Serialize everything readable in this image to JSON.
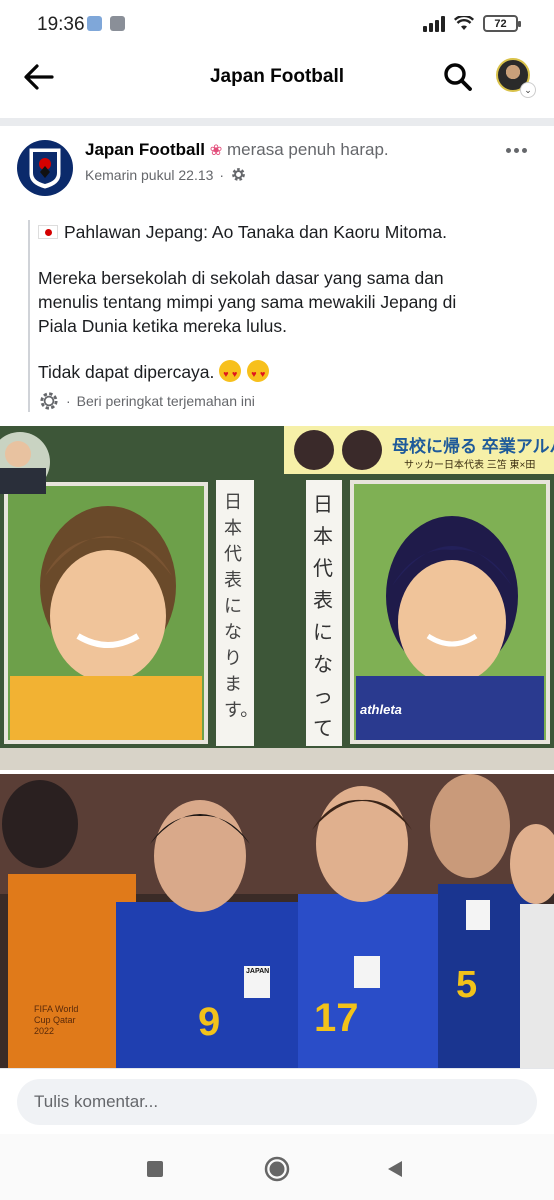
{
  "status_bar": {
    "time": "19:36",
    "battery": "72"
  },
  "header": {
    "title": "Japan Football"
  },
  "post": {
    "author": "Japan Football",
    "feeling": "merasa penuh harap.",
    "timestamp": "Kemarin pukul 22.13",
    "lines": {
      "l1": "Pahlawan Jepang: Ao Tanaka dan Kaoru Mitoma.",
      "l2": "Mereka bersekolah di sekolah dasar yang sama dan",
      "l3": "menulis tentang mimpi yang sama mewakili Jepang di",
      "l4": "Piala Dunia ketika mereka lulus.",
      "l5": "Tidak dapat dipercaya."
    },
    "translation_label": "Beri peringkat terjemahan ini"
  },
  "image_top": {
    "banner_jp": "母校に帰る 卒業アルバム",
    "subbanner_jp": "サッカー日本代表 三笘 東×田",
    "card_left_jp": "日本代表になります。",
    "card_right_jp": "日本代表になって",
    "shirt_text": "athleta"
  },
  "image_bottom": {
    "player_numbers": [
      "9",
      "17",
      "5"
    ],
    "crest_text": "JAPAN",
    "bib_text": "FIFA World Cup Qatar 2022"
  },
  "comment": {
    "placeholder": "Tulis komentar..."
  },
  "icons": {
    "back": "arrow-left-icon",
    "search": "search-icon",
    "more": "more-dots-icon",
    "gear": "gear-icon"
  },
  "colors": {
    "accent": "#1877f2",
    "header_text": "#050505",
    "meta_text": "#65676b",
    "comment_bg": "#f0f2f5"
  }
}
